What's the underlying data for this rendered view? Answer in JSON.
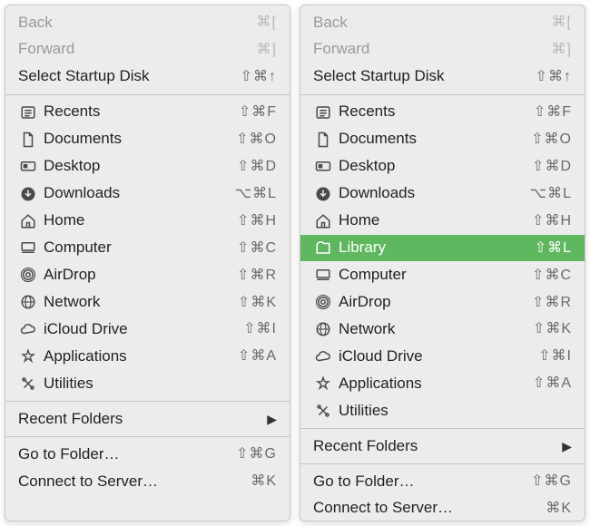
{
  "menus": [
    {
      "id": "left",
      "groups": [
        [
          {
            "key": "back",
            "label": "Back",
            "shortcut": "⌘[",
            "disabled": true,
            "noicon": true
          },
          {
            "key": "forward",
            "label": "Forward",
            "shortcut": "⌘]",
            "disabled": true,
            "noicon": true
          },
          {
            "key": "select-startup",
            "label": "Select Startup Disk",
            "shortcut": "⇧⌘↑",
            "noicon": true
          }
        ],
        [
          {
            "key": "recents",
            "label": "Recents",
            "shortcut": "⇧⌘F",
            "icon": "recents"
          },
          {
            "key": "documents",
            "label": "Documents",
            "shortcut": "⇧⌘O",
            "icon": "documents"
          },
          {
            "key": "desktop",
            "label": "Desktop",
            "shortcut": "⇧⌘D",
            "icon": "desktop"
          },
          {
            "key": "downloads",
            "label": "Downloads",
            "shortcut": "⌥⌘L",
            "icon": "downloads"
          },
          {
            "key": "home",
            "label": "Home",
            "shortcut": "⇧⌘H",
            "icon": "home"
          },
          {
            "key": "computer",
            "label": "Computer",
            "shortcut": "⇧⌘C",
            "icon": "computer"
          },
          {
            "key": "airdrop",
            "label": "AirDrop",
            "shortcut": "⇧⌘R",
            "icon": "airdrop"
          },
          {
            "key": "network",
            "label": "Network",
            "shortcut": "⇧⌘K",
            "icon": "network"
          },
          {
            "key": "icloud",
            "label": "iCloud Drive",
            "shortcut": "⇧⌘I",
            "icon": "icloud"
          },
          {
            "key": "applications",
            "label": "Applications",
            "shortcut": "⇧⌘A",
            "icon": "applications"
          },
          {
            "key": "utilities",
            "label": "Utilities",
            "shortcut": "",
            "icon": "utilities"
          }
        ],
        [
          {
            "key": "recent-folders",
            "label": "Recent Folders",
            "submenu": true,
            "noicon": true
          }
        ],
        [
          {
            "key": "goto",
            "label": "Go to Folder…",
            "shortcut": "⇧⌘G",
            "noicon": true
          },
          {
            "key": "connect",
            "label": "Connect to Server…",
            "shortcut": "⌘K",
            "noicon": true
          }
        ]
      ]
    },
    {
      "id": "right",
      "groups": [
        [
          {
            "key": "back",
            "label": "Back",
            "shortcut": "⌘[",
            "disabled": true,
            "noicon": true
          },
          {
            "key": "forward",
            "label": "Forward",
            "shortcut": "⌘]",
            "disabled": true,
            "noicon": true
          },
          {
            "key": "select-startup",
            "label": "Select Startup Disk",
            "shortcut": "⇧⌘↑",
            "noicon": true
          }
        ],
        [
          {
            "key": "recents",
            "label": "Recents",
            "shortcut": "⇧⌘F",
            "icon": "recents"
          },
          {
            "key": "documents",
            "label": "Documents",
            "shortcut": "⇧⌘O",
            "icon": "documents"
          },
          {
            "key": "desktop",
            "label": "Desktop",
            "shortcut": "⇧⌘D",
            "icon": "desktop"
          },
          {
            "key": "downloads",
            "label": "Downloads",
            "shortcut": "⌥⌘L",
            "icon": "downloads"
          },
          {
            "key": "home",
            "label": "Home",
            "shortcut": "⇧⌘H",
            "icon": "home"
          },
          {
            "key": "library",
            "label": "Library",
            "shortcut": "⇧⌘L",
            "icon": "library",
            "highlight": true
          },
          {
            "key": "computer",
            "label": "Computer",
            "shortcut": "⇧⌘C",
            "icon": "computer"
          },
          {
            "key": "airdrop",
            "label": "AirDrop",
            "shortcut": "⇧⌘R",
            "icon": "airdrop"
          },
          {
            "key": "network",
            "label": "Network",
            "shortcut": "⇧⌘K",
            "icon": "network"
          },
          {
            "key": "icloud",
            "label": "iCloud Drive",
            "shortcut": "⇧⌘I",
            "icon": "icloud"
          },
          {
            "key": "applications",
            "label": "Applications",
            "shortcut": "⇧⌘A",
            "icon": "applications"
          },
          {
            "key": "utilities",
            "label": "Utilities",
            "shortcut": "",
            "icon": "utilities"
          }
        ],
        [
          {
            "key": "recent-folders",
            "label": "Recent Folders",
            "submenu": true,
            "noicon": true
          }
        ],
        [
          {
            "key": "goto",
            "label": "Go to Folder…",
            "shortcut": "⇧⌘G",
            "noicon": true
          },
          {
            "key": "connect",
            "label": "Connect to Server…",
            "shortcut": "⌘K",
            "noicon": true
          }
        ]
      ]
    }
  ]
}
